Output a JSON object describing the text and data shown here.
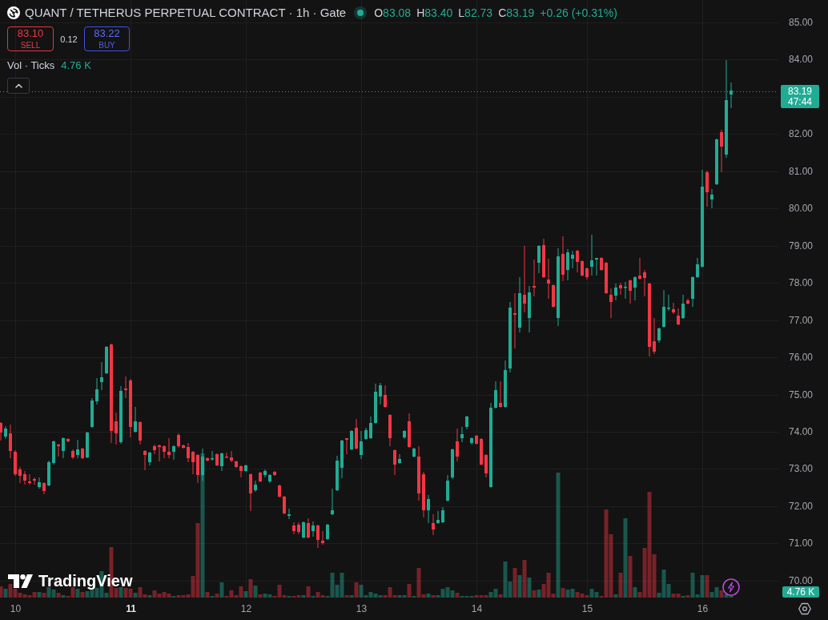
{
  "header": {
    "title": "QUANT / TETHERUS PERPETUAL CONTRACT · 1h · Gate",
    "ohlc": [
      {
        "label": "O",
        "value": "83.08"
      },
      {
        "label": "H",
        "value": "83.40"
      },
      {
        "label": "L",
        "value": "82.73"
      },
      {
        "label": "C",
        "value": "83.19"
      }
    ],
    "change": "+0.26 (+0.31%)"
  },
  "order_buttons": {
    "sell": {
      "price": "83.10",
      "label": "SELL"
    },
    "spread": "0.12",
    "buy": {
      "price": "83.22",
      "label": "BUY"
    }
  },
  "volume_legend": {
    "title": "Vol · Ticks",
    "value": "4.76 K"
  },
  "price_axis": {
    "labels": [
      "85.00",
      "84.00",
      "82.00",
      "81.00",
      "80.00",
      "79.00",
      "78.00",
      "77.00",
      "76.00",
      "75.00",
      "74.00",
      "73.00",
      "72.00",
      "71.00",
      "70.00"
    ],
    "last_price": "83.19",
    "countdown": "47:44",
    "volume_value": "4.76 K"
  },
  "time_axis": {
    "labels": [
      {
        "text": "10",
        "bold": false
      },
      {
        "text": "11",
        "bold": true
      },
      {
        "text": "12",
        "bold": false
      },
      {
        "text": "13",
        "bold": false
      },
      {
        "text": "14",
        "bold": false
      },
      {
        "text": "15",
        "bold": false
      },
      {
        "text": "16",
        "bold": false
      }
    ]
  },
  "branding": {
    "name": "TradingView"
  }
}
